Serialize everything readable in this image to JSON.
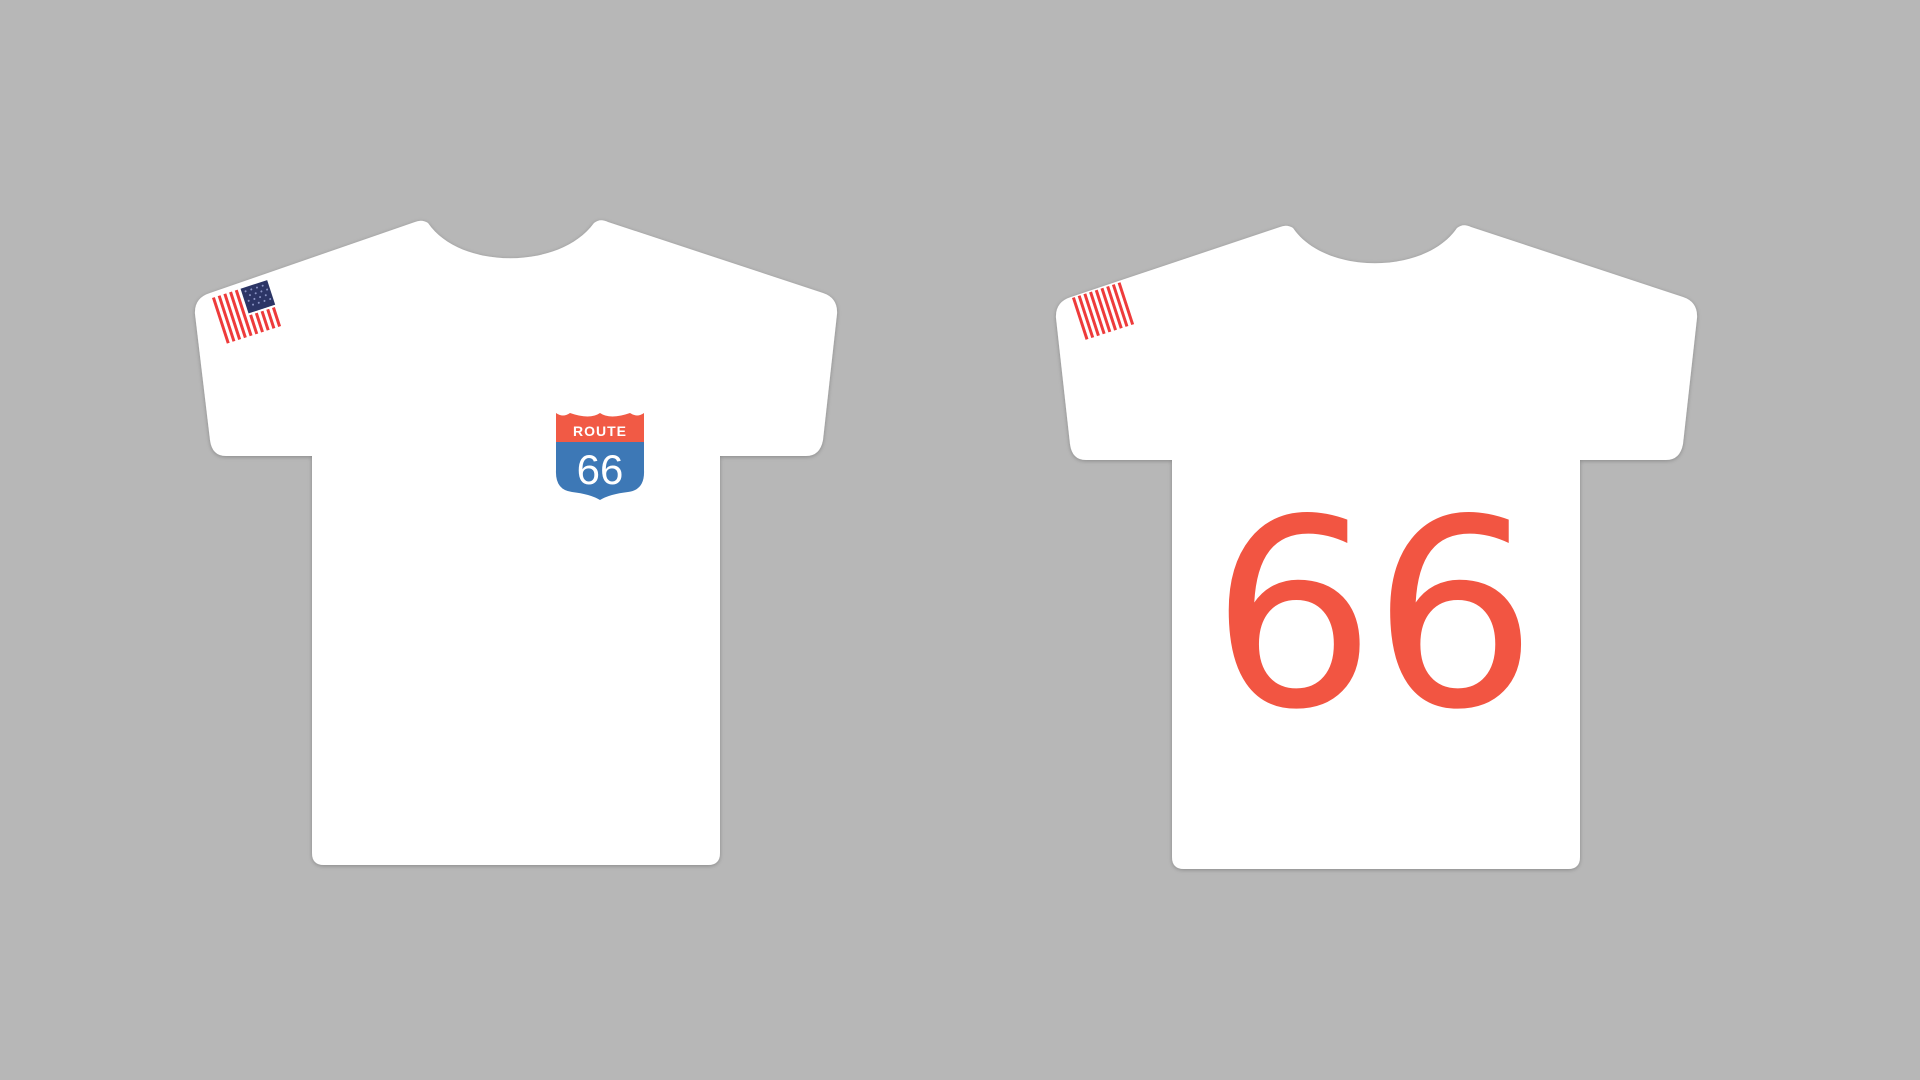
{
  "colors": {
    "background": "#b7b7b7",
    "shirt": "#ffffff",
    "shield_red": "#f15a45",
    "shield_blue": "#3d78b6",
    "flag_red": "#ee3b3b",
    "flag_navy": "#2c3566",
    "number_red": "#f25542"
  },
  "front": {
    "badge": {
      "top_text": "ROUTE",
      "number": "66"
    },
    "sleeve_patch": "us-flag"
  },
  "back": {
    "number": "66",
    "sleeve_patch": "us-flag"
  }
}
